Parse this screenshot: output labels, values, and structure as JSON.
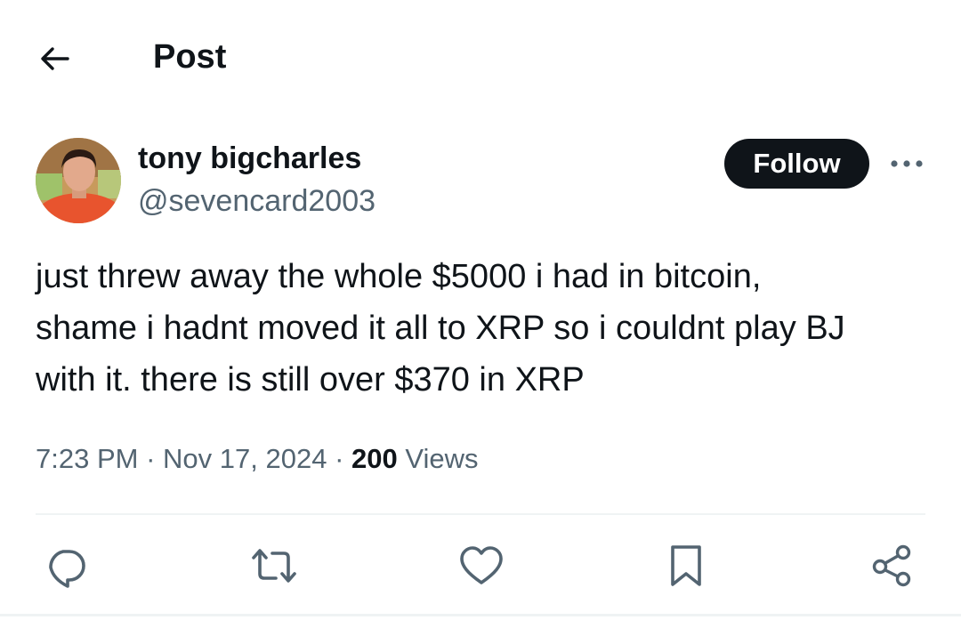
{
  "header": {
    "back_icon": "arrow-left-icon",
    "title": "Post"
  },
  "post": {
    "author": {
      "display_name": "tony bigcharles",
      "handle": "@sevencard2003"
    },
    "follow_label": "Follow",
    "more_icon": "ellipsis-icon",
    "text": "just threw away the whole $5000 i had in bitcoin,\nshame i hadnt moved it all to XRP so i couldnt play BJ\nwith it. there is still over $370 in XRP",
    "time": "7:23 PM",
    "date": "Nov 17, 2024",
    "separator": "·",
    "views_count": "200",
    "views_label": "Views"
  },
  "actions": [
    {
      "name": "reply",
      "icon": "reply-icon"
    },
    {
      "name": "repost",
      "icon": "repost-icon"
    },
    {
      "name": "like",
      "icon": "heart-icon"
    },
    {
      "name": "bookmark",
      "icon": "bookmark-icon"
    },
    {
      "name": "share",
      "icon": "share-icon"
    }
  ],
  "colors": {
    "text_primary": "#0f1419",
    "text_secondary": "#536471",
    "divider": "#eff3f4",
    "follow_bg": "#0f1419"
  }
}
